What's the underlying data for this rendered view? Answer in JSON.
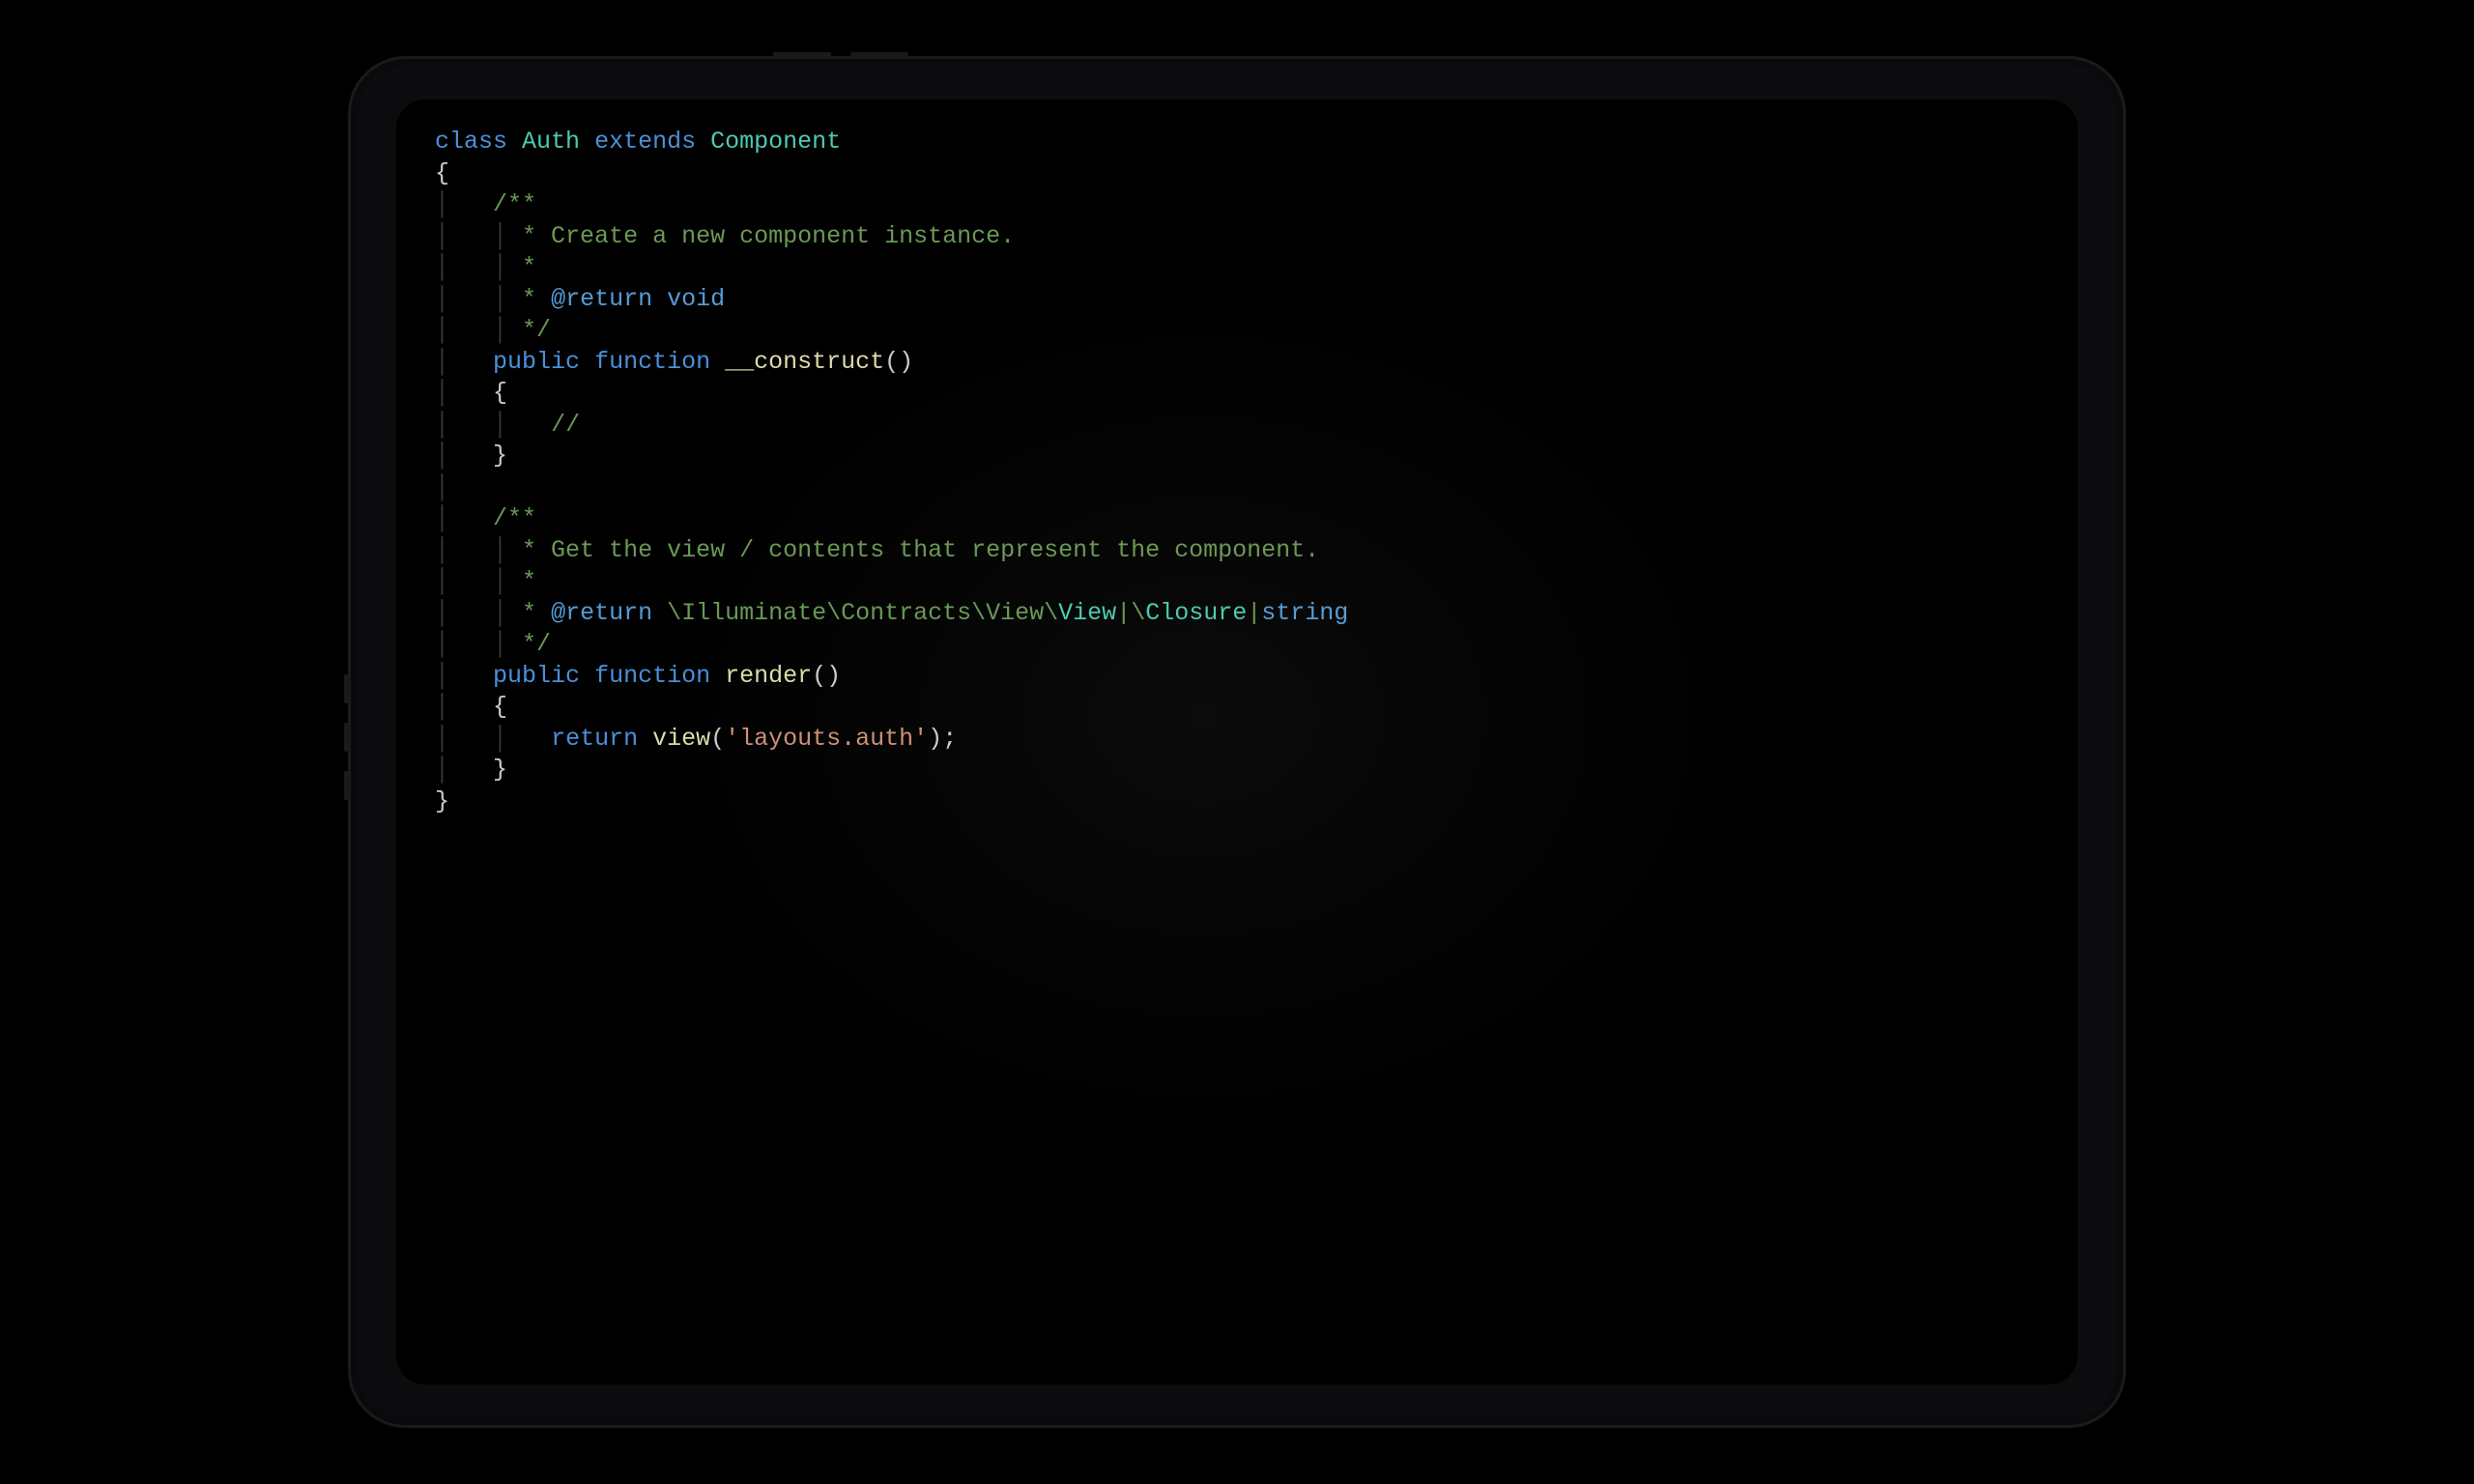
{
  "code": {
    "keywords": {
      "class": "class",
      "extends": "extends",
      "public": "public",
      "function": "function",
      "return": "return"
    },
    "classnames": {
      "auth": "Auth",
      "component": "Component",
      "view": "View",
      "closure": "Closure"
    },
    "builtins": {
      "void": "void",
      "string": "string"
    },
    "funcs": {
      "construct": "__construct",
      "render": "render",
      "view": "view"
    },
    "comments": {
      "doc1_open": "/**",
      "doc1_l1": " * Create a new component instance.",
      "doc1_l2": " *",
      "doc1_l3a": " * ",
      "doc1_l3b": "@return",
      "doc1_close": " */",
      "line_slashes": "//",
      "doc2_open": "/**",
      "doc2_l1": " * Get the view / contents that represent the component.",
      "doc2_l2": " *",
      "doc2_l3a": " * ",
      "doc2_l3b": "@return",
      "doc2_l3c": " \\Illuminate\\Contracts\\View\\",
      "doc2_l3p1": "|\\",
      "doc2_l3p2": "|",
      "doc2_close": " */"
    },
    "strings": {
      "layouts_auth": "'layouts.auth'"
    },
    "punct": {
      "obr": "{",
      "cbr": "}",
      "op": "(",
      "cp": ")",
      "opcP": "()",
      "semi": ";",
      "pipe": "|"
    },
    "indent": {
      "guide": "│",
      "sp1": "    ",
      "sp2": "        "
    }
  }
}
